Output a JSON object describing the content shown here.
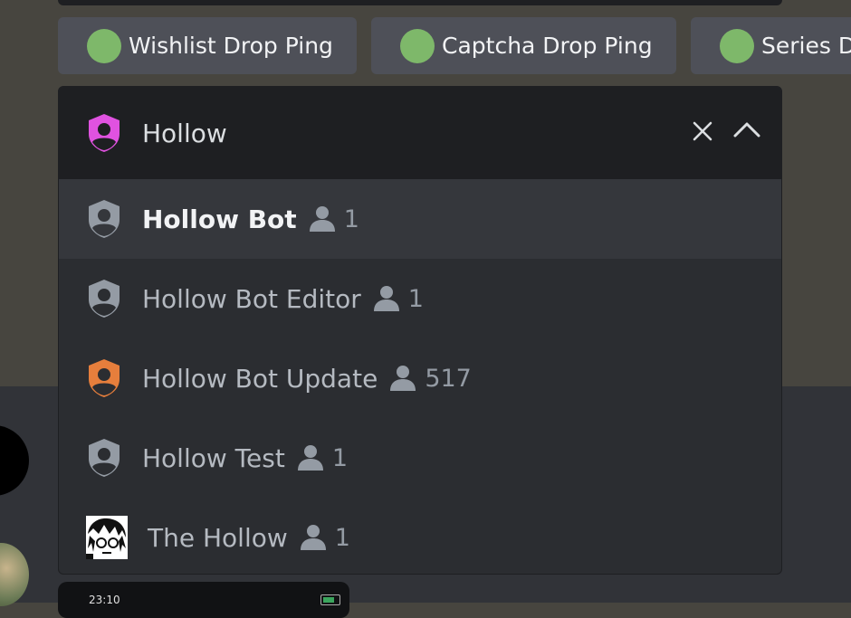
{
  "tags": [
    {
      "label": "Wishlist Drop Ping",
      "dot_color": "#7eb86a"
    },
    {
      "label": "Captcha Drop Ping",
      "dot_color": "#7eb86a"
    },
    {
      "label": "Series D",
      "dot_color": "#7eb86a"
    }
  ],
  "role_select": {
    "query": "Hollow",
    "query_icon_color": "#e052e0",
    "clear_icon": "close-icon",
    "collapse_icon": "chevron-up-icon",
    "options": [
      {
        "name": "Hollow Bot",
        "count": "1",
        "icon_color": "#949ba4",
        "selected": true
      },
      {
        "name": "Hollow Bot Editor",
        "count": "1",
        "icon_color": "#949ba4",
        "selected": false
      },
      {
        "name": "Hollow Bot Update",
        "count": "517",
        "icon_color": "#e67e3c",
        "selected": false
      },
      {
        "name": "Hollow Test",
        "count": "1",
        "icon_color": "#949ba4",
        "selected": false
      },
      {
        "name": "The Hollow",
        "count": "1",
        "icon_color": "",
        "selected": false
      }
    ]
  },
  "mini_window": {
    "clock": "23:10"
  },
  "colors": {
    "background_top": "#47453f",
    "background_bottom": "#313338",
    "dropdown_bg": "#2b2d31",
    "header_bg": "#1e1f22",
    "selected_bg": "#35373c"
  }
}
